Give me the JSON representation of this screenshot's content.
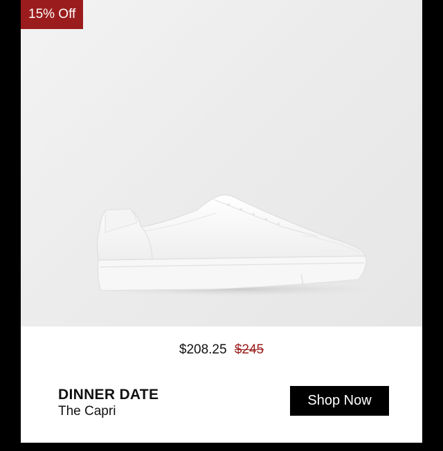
{
  "badge": {
    "label": "15% Off"
  },
  "product": {
    "image_icon": "white-low-top-sneaker",
    "price_current": "$208.25",
    "price_original": "$245",
    "title": "DINNER DATE",
    "subtitle": "The Capri"
  },
  "cta": {
    "label": "Shop Now"
  },
  "colors": {
    "badge_bg": "#9b1c1c",
    "original_price": "#9b1c1c",
    "button_bg": "#000000",
    "page_bg": "#000000"
  }
}
